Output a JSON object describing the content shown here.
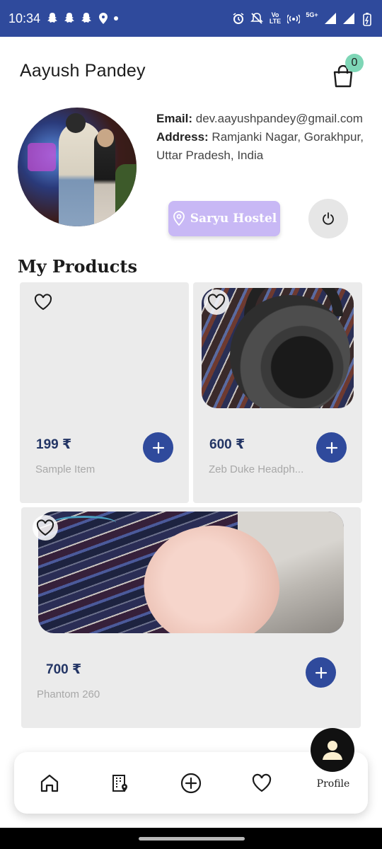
{
  "status_bar": {
    "time": "10:34",
    "left_icons": [
      "snapchat-icon",
      "snapchat-icon",
      "snapchat-icon",
      "location-tracking-icon",
      "dot-icon"
    ],
    "right_icons": [
      "alarm-icon",
      "mute-icon",
      "volte-icon",
      "hotspot-icon",
      "5g-icon",
      "signal-icon",
      "signal-icon",
      "battery-icon"
    ],
    "volte_text": "Vo\nLTE",
    "network_text": "5G+"
  },
  "header": {
    "user_name": "Aayush Pandey",
    "cart_count": "0"
  },
  "profile": {
    "email_label": "Email:",
    "email_value": "dev.aayushpandey@gmail.com",
    "address_label": "Address:",
    "address_value": "Ramjanki Nagar, Gorakhpur, Uttar Pradesh, India",
    "hostel_label": "Saryu Hostel"
  },
  "section_title": "My Products",
  "products": [
    {
      "price": "199 ₹",
      "name": "Sample Item"
    },
    {
      "price": "600 ₹",
      "name": "Zeb Duke Headph..."
    },
    {
      "price": "700 ₹",
      "name": "Phantom 260"
    }
  ],
  "bottom_nav": {
    "items": [
      "home-icon",
      "building-location-icon",
      "add-circle-icon",
      "heart-icon"
    ],
    "profile_label": "Profile"
  },
  "colors": {
    "accent": "#2f4a9c",
    "hostel_button": "#c8b8f5",
    "cart_badge": "#7ed6b6",
    "card_bg": "#ebebeb",
    "price": "#233565"
  }
}
